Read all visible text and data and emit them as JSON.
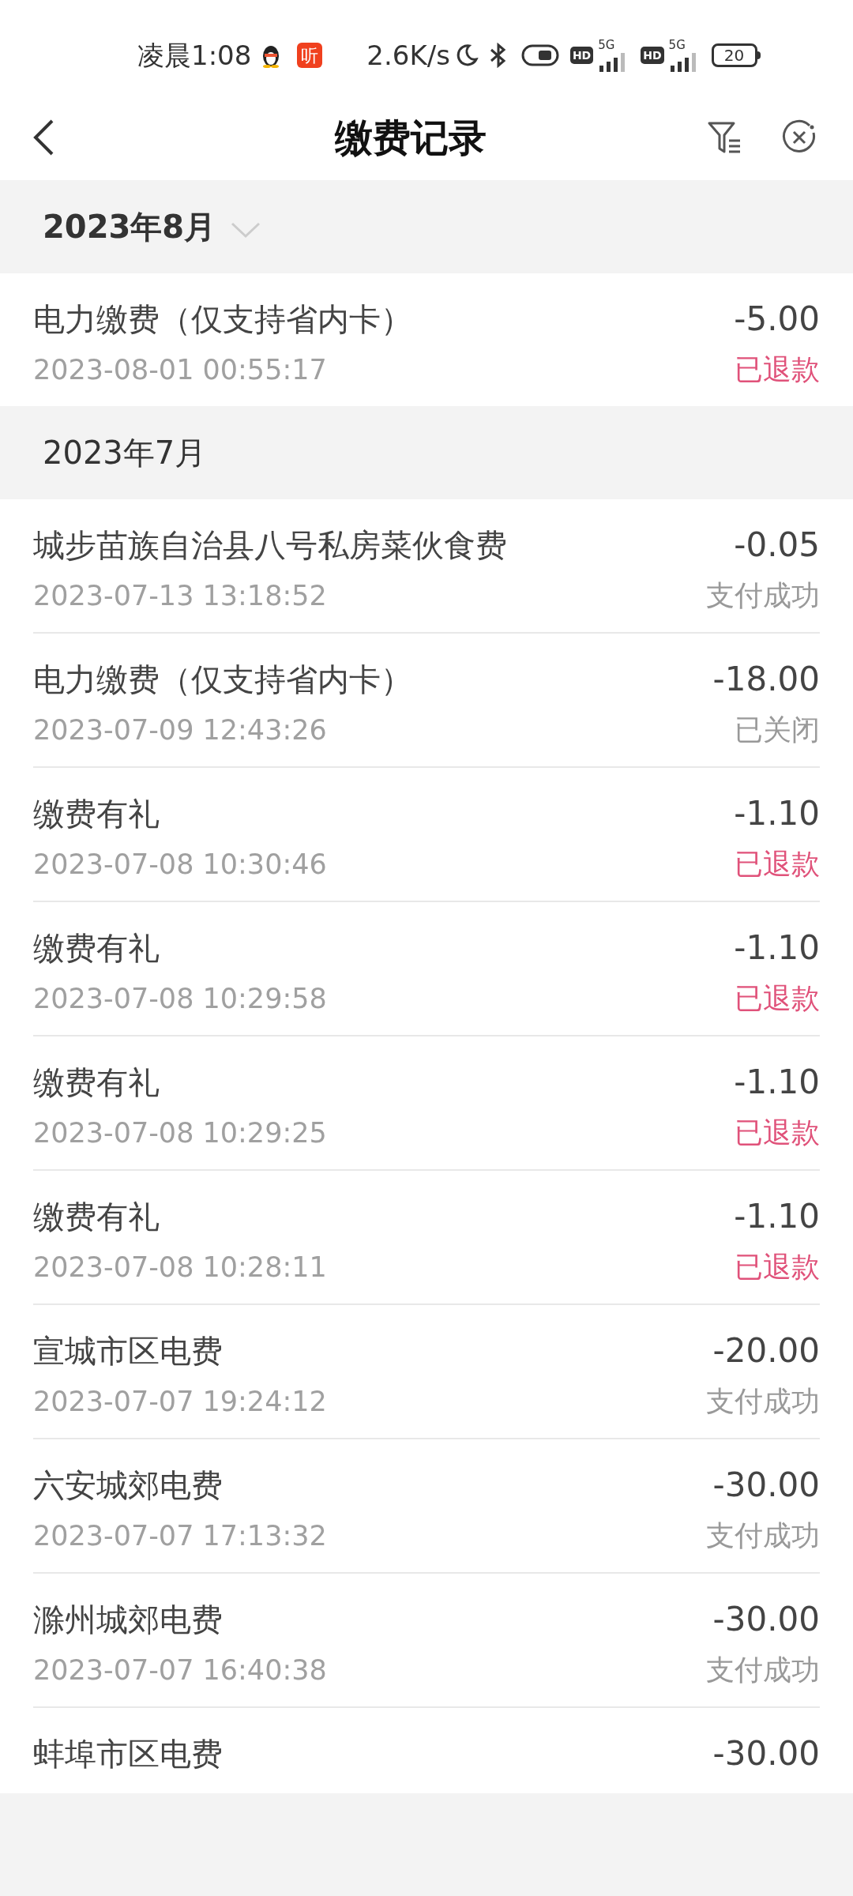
{
  "status_bar": {
    "time": "凌晨1:08",
    "app_badge": "听",
    "speed": "2.6K/s",
    "sims": [
      {
        "hd": "HD",
        "net": "5G"
      },
      {
        "hd": "HD",
        "net": "5G"
      }
    ],
    "battery": "20"
  },
  "header": {
    "title": "缴费记录"
  },
  "sections": [
    {
      "title": "2023年8月",
      "kind": "current",
      "records": [
        {
          "name": "电力缴费（仅支持省内卡）",
          "time": "2023-08-01 00:55:17",
          "amount": "-5.00",
          "status": "已退款",
          "refunded": true
        }
      ]
    },
    {
      "title": "2023年7月",
      "kind": "plain",
      "records": [
        {
          "name": "城步苗族自治县八号私房菜伙食费",
          "time": "2023-07-13 13:18:52",
          "amount": "-0.05",
          "status": "支付成功",
          "refunded": false
        },
        {
          "name": "电力缴费（仅支持省内卡）",
          "time": "2023-07-09 12:43:26",
          "amount": "-18.00",
          "status": "已关闭",
          "refunded": false
        },
        {
          "name": "缴费有礼",
          "time": "2023-07-08 10:30:46",
          "amount": "-1.10",
          "status": "已退款",
          "refunded": true
        },
        {
          "name": "缴费有礼",
          "time": "2023-07-08 10:29:58",
          "amount": "-1.10",
          "status": "已退款",
          "refunded": true
        },
        {
          "name": "缴费有礼",
          "time": "2023-07-08 10:29:25",
          "amount": "-1.10",
          "status": "已退款",
          "refunded": true
        },
        {
          "name": "缴费有礼",
          "time": "2023-07-08 10:28:11",
          "amount": "-1.10",
          "status": "已退款",
          "refunded": true
        },
        {
          "name": "宣城市区电费",
          "time": "2023-07-07 19:24:12",
          "amount": "-20.00",
          "status": "支付成功",
          "refunded": false
        },
        {
          "name": "六安城郊电费",
          "time": "2023-07-07 17:13:32",
          "amount": "-30.00",
          "status": "支付成功",
          "refunded": false
        },
        {
          "name": "滁州城郊电费",
          "time": "2023-07-07 16:40:38",
          "amount": "-30.00",
          "status": "支付成功",
          "refunded": false
        },
        {
          "name": "蚌埠市区电费",
          "amount": "-30.00"
        }
      ]
    }
  ]
}
